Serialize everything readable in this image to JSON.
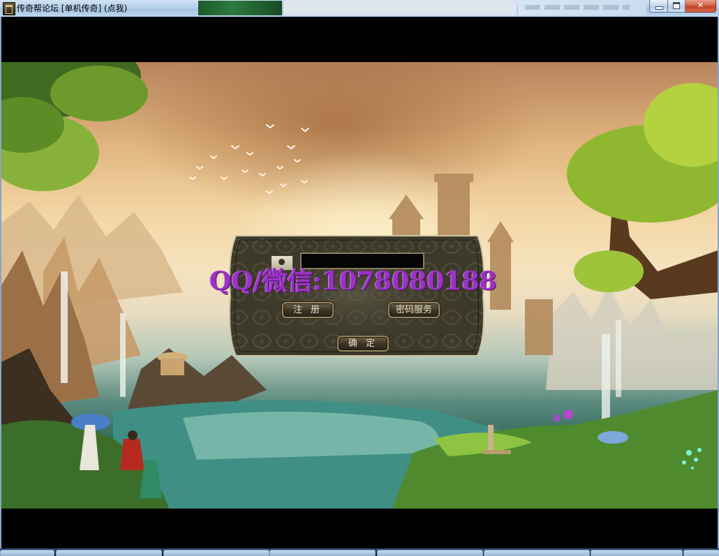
{
  "window": {
    "title": "传奇帮论坛 [单机传奇] (点我)"
  },
  "login": {
    "account_value": "",
    "register_label": "注 册",
    "password_service_label": "密码服务",
    "confirm_label": "确 定"
  },
  "watermark": {
    "text": "QQ/微信:1078080188"
  },
  "colors": {
    "watermark": "#9b32c6",
    "dialog_frame": "#8a7d5c"
  }
}
